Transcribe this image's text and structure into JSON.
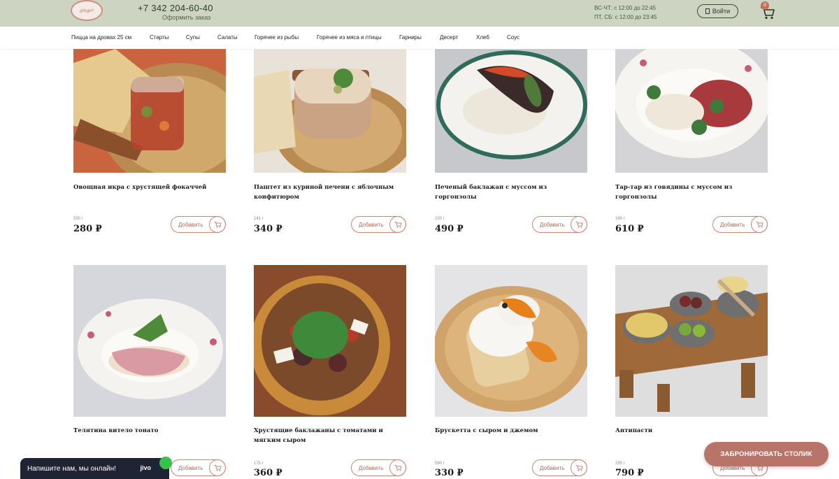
{
  "header": {
    "logo_text": "ginger",
    "phone": "+7 342 204-60-40",
    "order_link": "Оформить заказ",
    "hours": [
      "ВС-ЧТ: с 12:00 до 22:45",
      "ПТ, СБ: с 12:00 до 23:45"
    ],
    "login_label": "Войти",
    "cart_count": "0"
  },
  "nav": {
    "items": [
      "Пицца на дровах 25 см",
      "Старты",
      "Супы",
      "Салаты",
      "Горячее из рыбы",
      "Горячее из мяса и птицы",
      "Гарниры",
      "Десерт",
      "Хлеб",
      "Соус"
    ]
  },
  "products": [
    {
      "name": "Овощная икра с хрустящей фокаччей",
      "weight": "550 г",
      "price": "280 ₽",
      "add_label": "Добавить"
    },
    {
      "name": "Паштет из куриной печени с яблочным конфитюром",
      "weight": "141 г",
      "price": "340 ₽",
      "add_label": "Добавить"
    },
    {
      "name": "Печеный баклажан с муссом из горгонзолы",
      "weight": "220 г",
      "price": "490 ₽",
      "add_label": "Добавить"
    },
    {
      "name": "Тар-тар из говядины с муссом из горгонзолы",
      "weight": "160 г",
      "price": "610 ₽",
      "add_label": "Добавить"
    },
    {
      "name": "Телятина витело тонато",
      "weight": "",
      "price": "",
      "add_label": "Добавить"
    },
    {
      "name": "Хрустящие баклажаны с томатами и мягким сыром",
      "weight": "175 г",
      "price": "360 ₽",
      "add_label": "Добавить"
    },
    {
      "name": "Брускетта с сыром и джемом",
      "weight": "090 г",
      "price": "330 ₽",
      "add_label": "Добавить"
    },
    {
      "name": "Антипасти",
      "weight": "235 г",
      "price": "790 ₽",
      "add_label": "Добавить"
    }
  ],
  "book_button": "ЗАБРОНИРОВАТЬ СТОЛИК",
  "chat": {
    "text": "Напишите нам, мы онлайн!",
    "brand": "jivo"
  },
  "colors": {
    "header_bg": "#cdd5c2",
    "accent": "#c9877a",
    "book_button_bg": "#b9746a"
  }
}
